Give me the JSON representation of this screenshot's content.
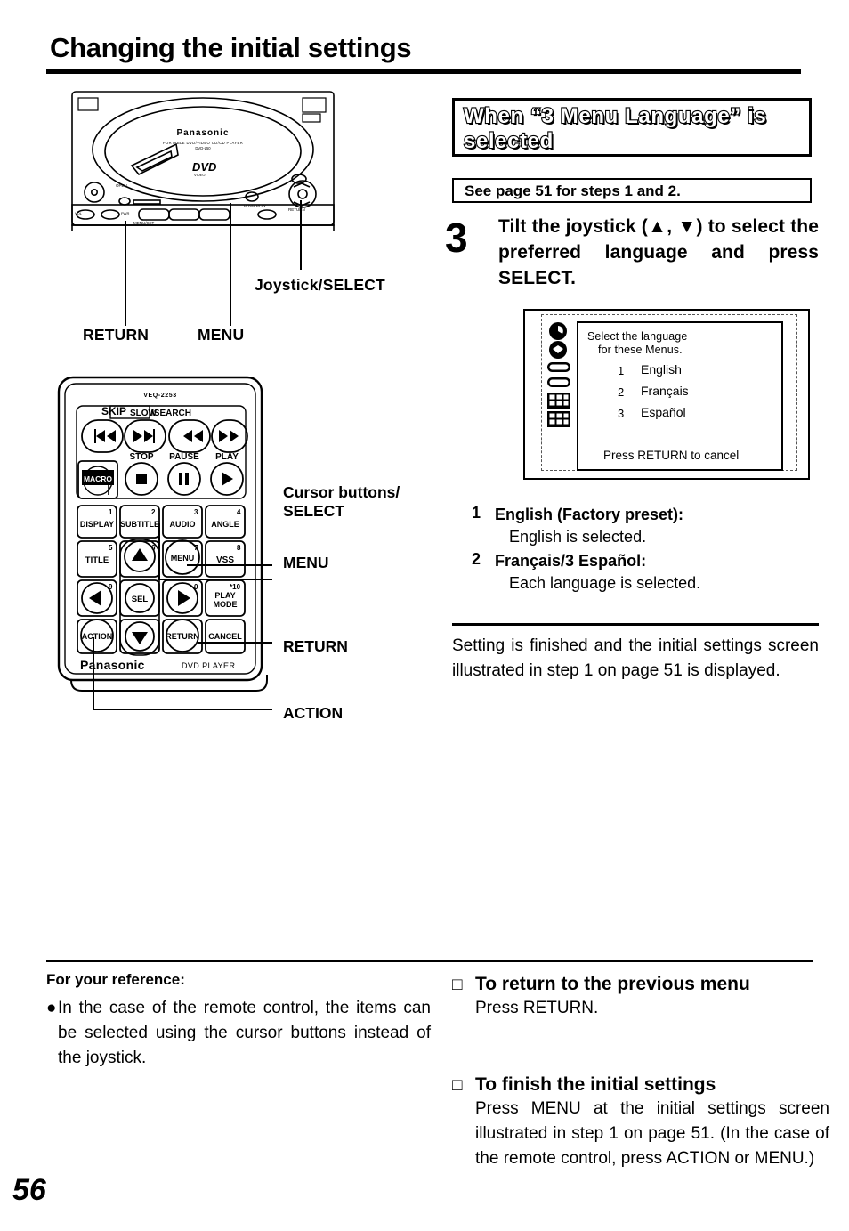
{
  "page": {
    "title": "Changing the initial settings",
    "number": "56"
  },
  "player_figure": {
    "brand": "Panasonic",
    "model_line": "PORTABLE DVD/VIDEO CD/CD PLAYER",
    "model_code": "DVD-L50",
    "disc_logo": "DVD",
    "disc_logo_sub": "VIDEO",
    "callouts": [
      {
        "label": "RETURN"
      },
      {
        "label": "MENU"
      },
      {
        "label": "Joystick/SELECT"
      }
    ]
  },
  "remote_figure": {
    "model": "VEQ-2253",
    "brand": "Panasonic",
    "device_label": "DVD PLAYER",
    "group_labels": {
      "skip": "SKIP",
      "slow": "SLOW",
      "slow_search": "/SEARCH",
      "stop": "STOP",
      "pause": "PAUSE",
      "play": "PLAY"
    },
    "macro_button": "MACRO",
    "keypad": [
      {
        "num": "1",
        "label": "DISPLAY"
      },
      {
        "num": "2",
        "label": "SUBTITLE"
      },
      {
        "num": "3",
        "label": "AUDIO"
      },
      {
        "num": "4",
        "label": "ANGLE"
      },
      {
        "num": "5",
        "label": "TITLE"
      },
      {
        "num": "6",
        "label": ""
      },
      {
        "num": "7",
        "label": "MENU"
      },
      {
        "num": "8",
        "label": "VSS"
      },
      {
        "num": "9",
        "label": ""
      },
      {
        "num": "",
        "label": "SEL"
      },
      {
        "num": "0",
        "label": ""
      },
      {
        "num": "*10",
        "label": "PLAY MODE"
      },
      {
        "num": "",
        "label": "ACTION"
      },
      {
        "num": "",
        "label": ""
      },
      {
        "num": "",
        "label": "RETURN"
      },
      {
        "num": "",
        "label": "CANCEL"
      }
    ],
    "callouts": [
      {
        "label_line1": "Cursor buttons/",
        "label_line2": "SELECT"
      },
      {
        "label_line1": "MENU",
        "label_line2": ""
      },
      {
        "label_line1": "RETURN",
        "label_line2": ""
      },
      {
        "label_line1": "ACTION",
        "label_line2": ""
      }
    ]
  },
  "section": {
    "heading": "When “3 Menu Language” is selected",
    "see_page": "See page 51 for steps 1 and 2."
  },
  "step3": {
    "number": "3",
    "text": "Tilt the joystick (▲, ▼) to select the preferred language and press SELECT."
  },
  "osd": {
    "title_line1": "Select the language",
    "title_line2": "for these Menus.",
    "options": [
      {
        "num": "1",
        "label": "English"
      },
      {
        "num": "2",
        "label": "Français"
      },
      {
        "num": "3",
        "label": "Español"
      }
    ],
    "cancel_text": "Press RETURN to cancel",
    "icons": [
      "audio-disc-icon",
      "subtitle-disc-icon",
      "menu-bar-icon",
      "menu-bar-2-icon",
      "grid-menu-icon",
      "grid-menu-2-icon"
    ]
  },
  "language_list": [
    {
      "num": "1",
      "bold": "English (Factory preset):",
      "plain": "English is selected."
    },
    {
      "num": "2",
      "bold": "Français/3  Español:",
      "plain": "Each language is selected."
    }
  ],
  "finish_note": "Setting is finished and the initial settings screen illustrated in step 1 on page 51 is displayed.",
  "reference": {
    "heading": "For your reference:",
    "bullet_char": "●",
    "bullet": "In the case of the remote control, the items can be selected using the cursor buttons instead of the joystick."
  },
  "sub_sections": [
    {
      "square": "□",
      "heading": "To return to the previous menu",
      "body": "Press RETURN."
    },
    {
      "square": "□",
      "heading": "To finish the initial settings",
      "body": "Press MENU at the initial settings screen illustrated in step 1 on page 51. (In the case of the remote control, press ACTION or MENU.)"
    }
  ]
}
